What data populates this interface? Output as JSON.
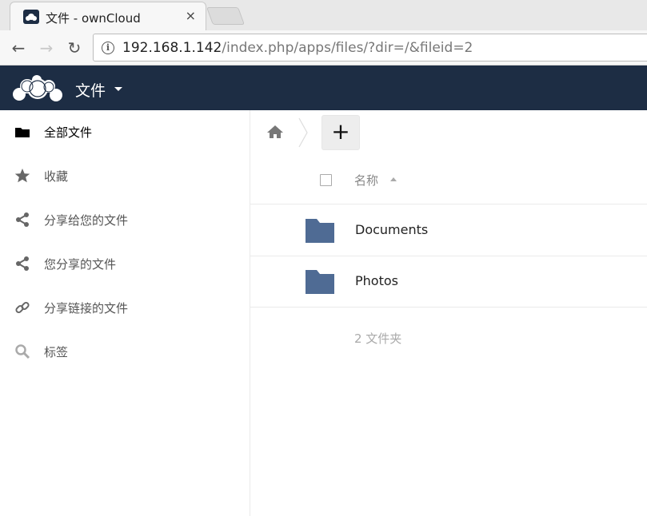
{
  "browser": {
    "tab_title": "文件 - ownCloud",
    "tab_close": "×",
    "url_host": "192.168.1.142",
    "url_path": "/index.php/apps/files/?dir=/&fileid=2"
  },
  "app": {
    "name": "文件",
    "brand_color": "#1d2d44"
  },
  "sidebar": {
    "items": [
      {
        "label": "全部文件",
        "icon": "folder-icon",
        "active": true
      },
      {
        "label": "收藏",
        "icon": "star-icon",
        "active": false
      },
      {
        "label": "分享给您的文件",
        "icon": "share-icon",
        "active": false
      },
      {
        "label": "您分享的文件",
        "icon": "share-icon",
        "active": false
      },
      {
        "label": "分享链接的文件",
        "icon": "link-icon",
        "active": false
      },
      {
        "label": "标签",
        "icon": "tag-search-icon",
        "active": false
      }
    ]
  },
  "toolbar": {
    "add_label": "+"
  },
  "file_list": {
    "column_name": "名称",
    "rows": [
      {
        "name": "Documents",
        "type": "folder"
      },
      {
        "name": "Photos",
        "type": "folder"
      }
    ],
    "summary": "2 文件夹",
    "folder_color": "#4f6b94"
  }
}
